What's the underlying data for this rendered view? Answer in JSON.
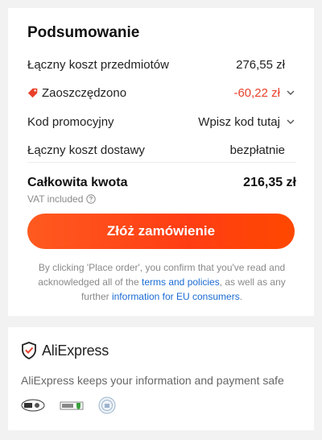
{
  "summary": {
    "title": "Podsumowanie",
    "items_cost_label": "Łączny koszt przedmiotów",
    "items_cost_value": "276,55 zł",
    "saved_label": "Zaoszczędzono",
    "saved_value": "-60,22 zł",
    "promo_label": "Kod promocyjny",
    "promo_placeholder": "Wpisz kod tutaj",
    "shipping_label": "Łączny koszt dostawy",
    "shipping_value": "bezpłatnie",
    "total_label": "Całkowita kwota",
    "total_value": "216,35 zł",
    "vat_note": "VAT included",
    "order_button": "Złóż zamówienie",
    "legal_pre": "By clicking 'Place order', you confirm that you've read and acknowledged all of the ",
    "legal_link1": "terms and policies",
    "legal_mid": ", as well as any further ",
    "legal_link2": "information for EU consumers",
    "legal_post": "."
  },
  "trust": {
    "brand": "AliExpress",
    "message": "AliExpress keeps your information and payment safe"
  },
  "colors": {
    "accent": "#ff4a17",
    "discount": "#e8412b",
    "link": "#1a6bd3"
  }
}
